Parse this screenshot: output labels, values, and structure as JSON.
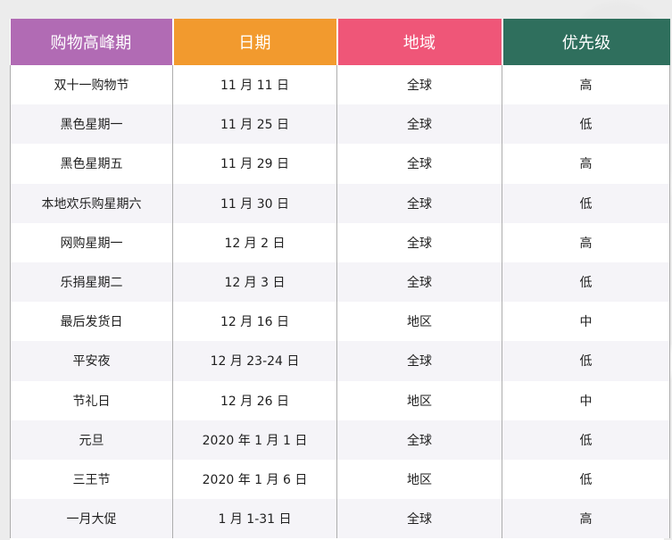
{
  "headers": {
    "period": "购物高峰期",
    "date": "日期",
    "region": "地域",
    "priority": "优先级"
  },
  "rows": [
    {
      "period": "双十一购物节",
      "date": "11 月 11 日",
      "region": "全球",
      "priority": "高"
    },
    {
      "period": "黑色星期一",
      "date": "11 月 25 日",
      "region": "全球",
      "priority": "低"
    },
    {
      "period": "黑色星期五",
      "date": "11 月 29 日",
      "region": "全球",
      "priority": "高"
    },
    {
      "period": "本地欢乐购星期六",
      "date": "11 月 30 日",
      "region": "全球",
      "priority": "低"
    },
    {
      "period": "网购星期一",
      "date": "12 月 2 日",
      "region": "全球",
      "priority": "高"
    },
    {
      "period": "乐捐星期二",
      "date": "12 月 3 日",
      "region": "全球",
      "priority": "低"
    },
    {
      "period": "最后发货日",
      "date": "12 月 16 日",
      "region": "地区",
      "priority": "中"
    },
    {
      "period": "平安夜",
      "date": "12 月 23-24 日",
      "region": "全球",
      "priority": "低"
    },
    {
      "period": "节礼日",
      "date": "12 月 26 日",
      "region": "地区",
      "priority": "中"
    },
    {
      "period": "元旦",
      "date": "2020 年 1 月 1 日",
      "region": "全球",
      "priority": "低"
    },
    {
      "period": "三王节",
      "date": "2020 年 1 月 6 日",
      "region": "地区",
      "priority": "低"
    },
    {
      "period": "一月大促",
      "date": "1 月 1-31 日",
      "region": "全球",
      "priority": "高"
    }
  ],
  "colors": {
    "period_header": "#b16bb4",
    "date_header": "#f29a2e",
    "region_header": "#ef5678",
    "priority_header": "#2f6f5d"
  }
}
